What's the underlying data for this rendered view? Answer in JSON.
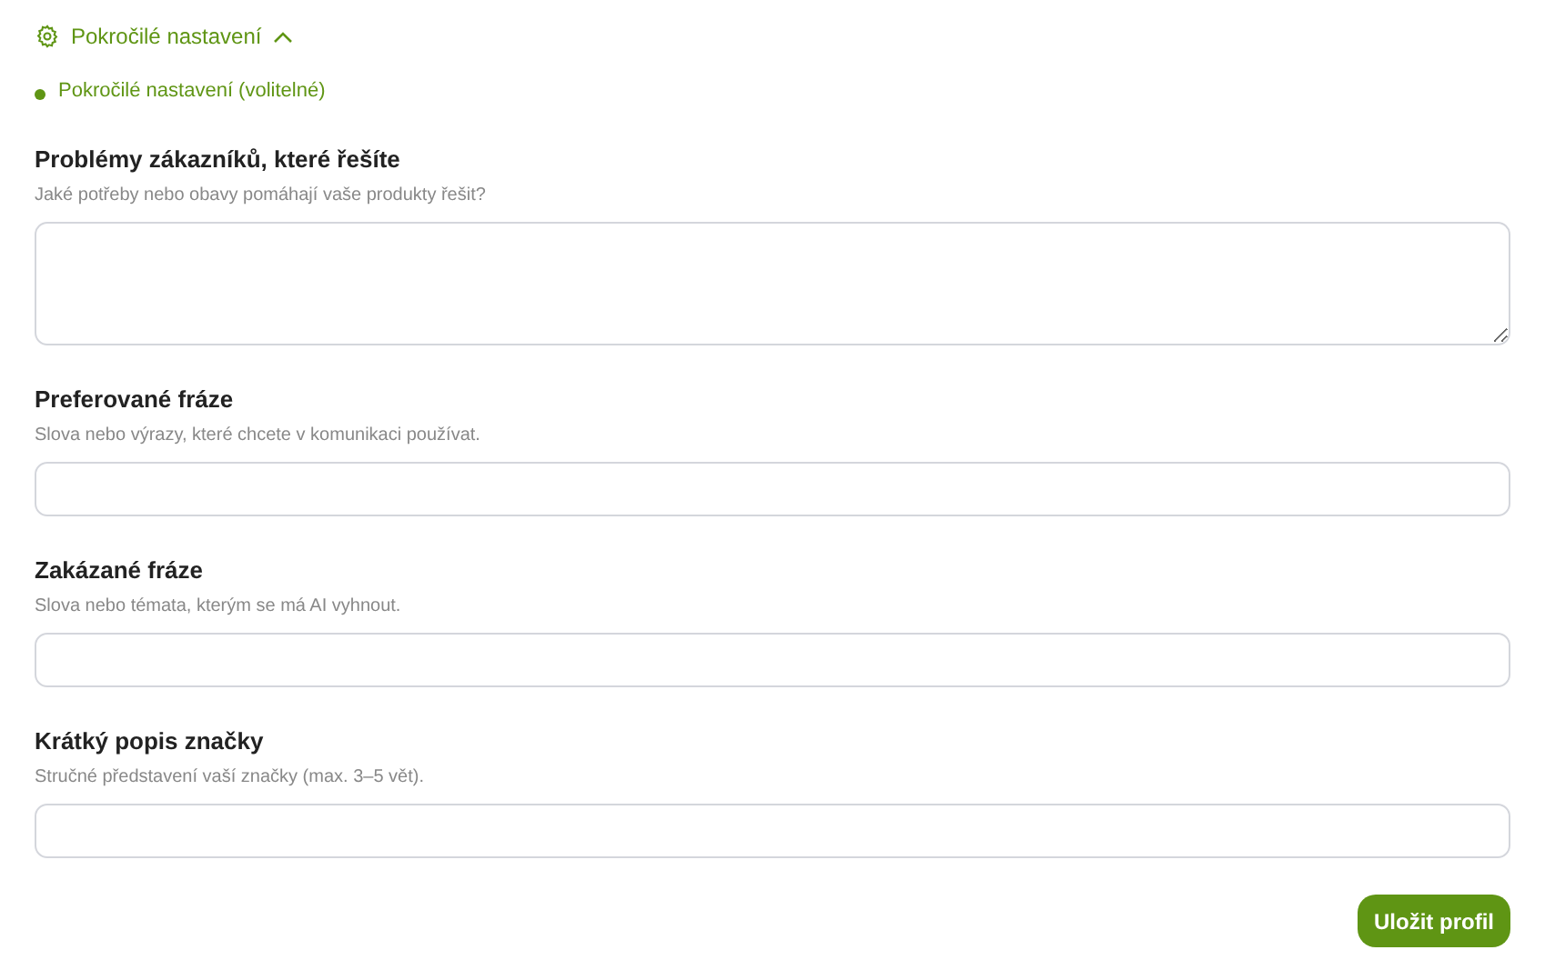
{
  "advanced_toggle": {
    "label": "Pokročilé nastavení",
    "expanded": true
  },
  "section": {
    "title": "Pokročilé nastavení (volitelné)",
    "color": "#5f9514"
  },
  "fields": [
    {
      "kind": "textarea",
      "label": "Problémy zákazníků, které řešíte",
      "hint": "Jaké potřeby nebo obavy pomáhají vaše produkty řešit?"
    },
    {
      "kind": "input",
      "label": "Preferované fráze",
      "hint": "Slova nebo výrazy, které chcete v komunikaci používat."
    },
    {
      "kind": "input",
      "label": "Zakázané fráze",
      "hint": "Slova nebo témata, kterým se má AI vyhnout."
    },
    {
      "kind": "input",
      "label": "Krátký popis značky",
      "hint": "Stručné představení vaší značky (max. 3–5 vět)."
    }
  ],
  "save_button": "Uložit profil"
}
